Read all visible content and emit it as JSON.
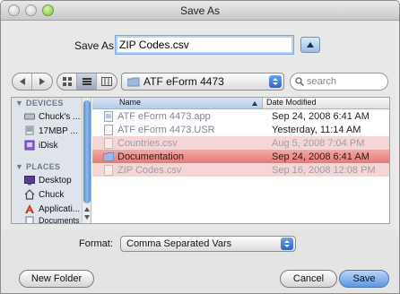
{
  "window": {
    "title": "Save As"
  },
  "save_as": {
    "label": "Save As:",
    "value": "ZIP Codes.csv"
  },
  "path_popup": {
    "label": "ATF eForm 4473"
  },
  "search": {
    "placeholder": "search"
  },
  "sidebar": {
    "sections": [
      {
        "header": "DEVICES",
        "items": [
          {
            "label": "Chuck's ...",
            "icon": "hard-drive-icon"
          },
          {
            "label": "17MBP ...",
            "icon": "laptop-icon"
          },
          {
            "label": "iDisk",
            "icon": "idisk-icon"
          }
        ]
      },
      {
        "header": "PLACES",
        "items": [
          {
            "label": "Desktop",
            "icon": "desktop-icon"
          },
          {
            "label": "Chuck",
            "icon": "home-icon"
          },
          {
            "label": "Applicati...",
            "icon": "applications-icon"
          },
          {
            "label": "Documents",
            "icon": "documents-icon"
          }
        ]
      }
    ]
  },
  "list": {
    "columns": {
      "name": "Name",
      "date": "Date Modified"
    },
    "rows": [
      {
        "name": "ATF eForm 4473.app",
        "date": "Sep 24, 2008 6:41 AM",
        "style": "grey-blue"
      },
      {
        "name": "ATF eForm 4473.USR",
        "date": "Yesterday, 11:14 AM",
        "style": "grey-blue"
      },
      {
        "name": "Countries.csv",
        "date": "Aug 5, 2008 7:04 PM",
        "style": "dim pink"
      },
      {
        "name": "Documentation",
        "date": "Sep 24, 2008 6:41 AM",
        "style": "sel"
      },
      {
        "name": "ZIP Codes.csv",
        "date": "Sep 16, 2008 12:08 PM",
        "style": "dim pink"
      }
    ]
  },
  "format": {
    "label": "Format:",
    "value": "Comma Separated Vars"
  },
  "buttons": {
    "new_folder": "New Folder",
    "cancel": "Cancel",
    "save": "Save"
  },
  "colors": {
    "selection": "#e47a76",
    "accent": "#5d97e0"
  }
}
